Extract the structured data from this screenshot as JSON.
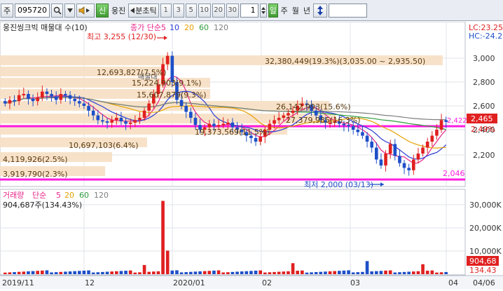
{
  "toolbar": {
    "market": "주",
    "code": "095720",
    "credit_label": "신",
    "stock_name": "웅진",
    "tick_label": "분초틱",
    "intervals": [
      "1",
      "3",
      "5",
      "10",
      "20",
      "30"
    ],
    "period_value": "1",
    "period_buttons": [
      "일",
      "주",
      "월",
      "년"
    ]
  },
  "price_panel": {
    "title": "웅진씽크빅 매물대 수(10)",
    "ma_label": "종가 단순",
    "ma_periods": [
      "5",
      "10",
      "20",
      "60",
      "120"
    ],
    "ma_colors": [
      "#e8268a",
      "#2a3bd6",
      "#e5a100",
      "#2e9c3d",
      "#7f7f7f"
    ],
    "lc": "LC:23.25",
    "hc": "HC:-24.2",
    "y_ticks": [
      "3,000",
      "2,800",
      "2,600",
      "2,400",
      "2,200"
    ],
    "current_price": "2,465",
    "current_pct": "2,49%",
    "price_2422": "2,422",
    "line_2046": "2,046",
    "high_note": "최고 3,255 (12/30)",
    "low_note": "최저 2,000 (03/13)",
    "volume_profile": [
      {
        "label": "32,380,449(19.3%)(3,035.00 ~ 2,935.50)"
      },
      {
        "label": "12,693,827(7.5%)"
      },
      {
        "label": "15,224,903(9.1%)"
      },
      {
        "label": "15,607,879(9.3%)"
      },
      {
        "label": "26,142,993(15.6%)"
      },
      {
        "label": "27,379,985(16.3%)"
      },
      {
        "label": "10,697,103(6.4%)"
      },
      {
        "label": "19,373,569(11.5%)"
      },
      {
        "label": "4,119,926(2.5%)"
      },
      {
        "label": "3,919,790(2.3%)"
      }
    ],
    "overlay_text": "매물대"
  },
  "volume_panel": {
    "title": "거래량",
    "ma_label": "단순",
    "ma_periods": [
      "5",
      "20",
      "60",
      "120"
    ],
    "ma_colors": [
      "#e8268a",
      "#e5a100",
      "#2e9c3d",
      "#7f7f7f"
    ],
    "info": "904,687주(134.43%)",
    "y_ticks": [
      "30,000K",
      "20,000K",
      "10,000K"
    ],
    "cur_value": "904,68",
    "cur_pct": "134.43"
  },
  "x_axis": [
    "2019/11",
    "12",
    "2020/01",
    "02",
    "03",
    "04",
    "04/06"
  ],
  "colors": {
    "up": "#e02020",
    "down": "#1e4fc8",
    "magenta": "#ff1ce0",
    "profile": "#f6dfc3"
  },
  "chart_data": {
    "type": "candlestick",
    "price_range": [
      2000,
      3255
    ],
    "volume_unit": "K"
  }
}
